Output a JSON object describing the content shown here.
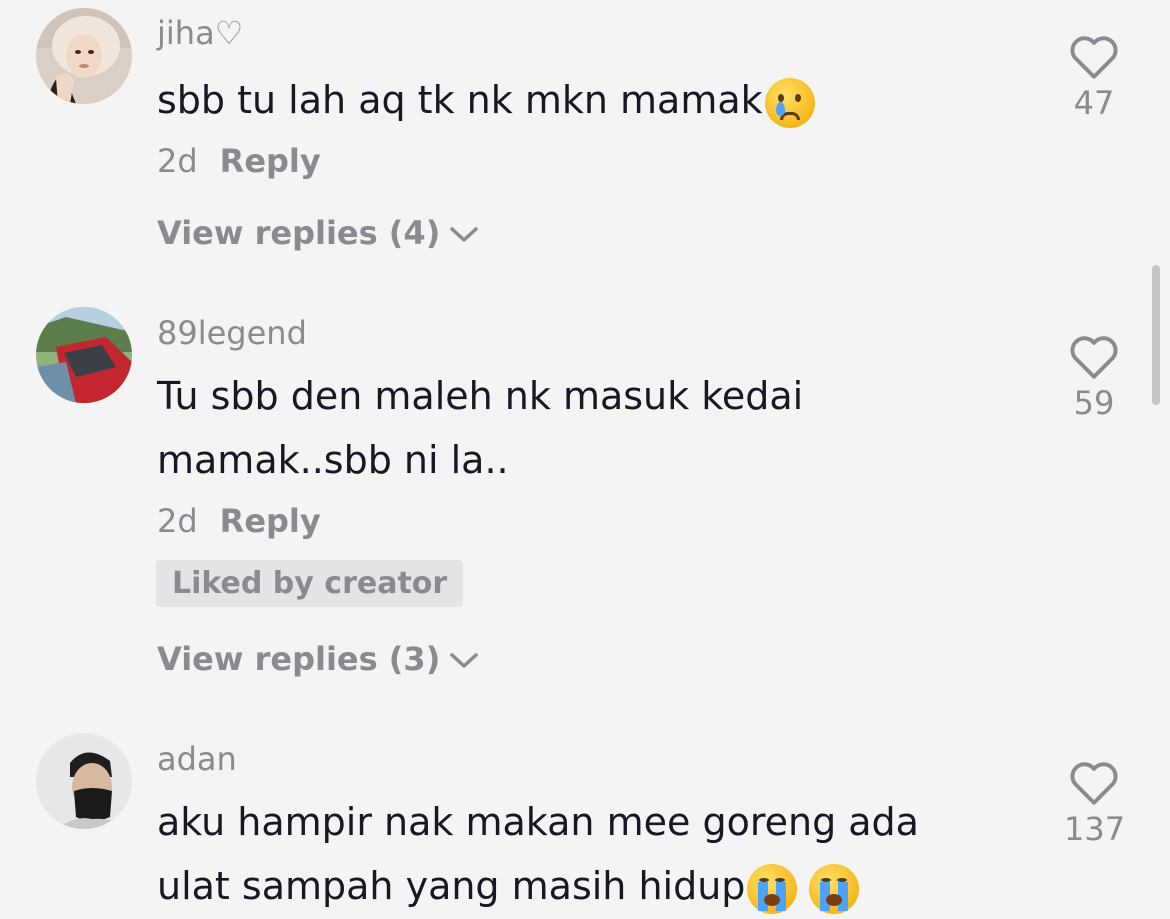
{
  "comments": [
    {
      "username": "jiha♡",
      "lines": [
        "sbb tu lah aq tk nk mkn mamak"
      ],
      "time": "2d",
      "reply_label": "Reply",
      "likes": "47",
      "view_replies": "View replies (4)",
      "avatar": "girl-avatar"
    },
    {
      "username": "89legend",
      "lines": [
        "Tu sbb den maleh nk masuk kedai",
        "mamak..sbb ni la.."
      ],
      "time": "2d",
      "reply_label": "Reply",
      "likes": "59",
      "badge": "Liked by creator",
      "view_replies": "View replies (3)",
      "avatar": "car-avatar"
    },
    {
      "username": "adan",
      "lines": [
        "aku hampir nak makan mee goreng ada",
        "ulat sampah yang masih hidup"
      ],
      "likes": "137",
      "avatar": "masked-man-avatar"
    }
  ],
  "icons": {
    "like": "heart-outline-icon",
    "expand": "chevron-down-icon",
    "emoji_1": "sad-tear-emoji",
    "emoji_2": "loudly-crying-emoji"
  },
  "colors": {
    "background": "#f4f4f4",
    "text": "#161823",
    "secondary": "#8a8b91",
    "badge_bg": "#e4e4e6"
  }
}
